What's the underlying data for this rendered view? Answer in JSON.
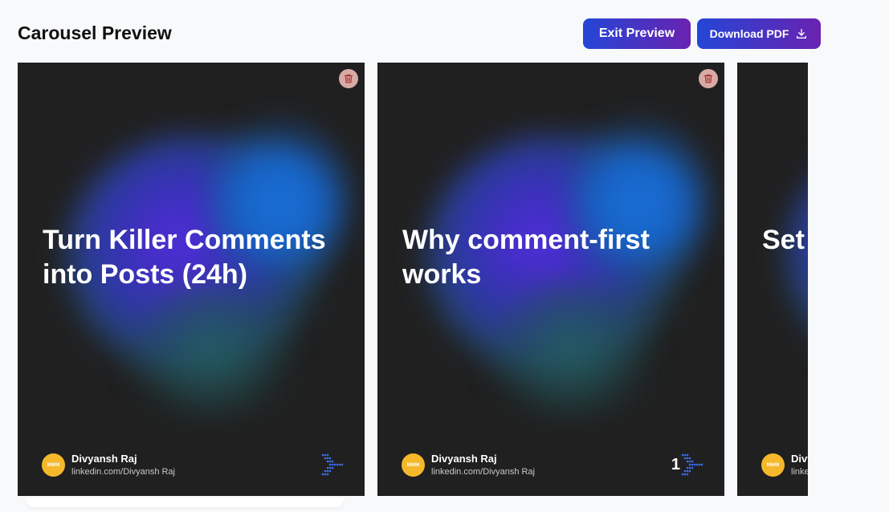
{
  "header": {
    "title": "Carousel Preview",
    "exit_label": "Exit Preview",
    "download_label": "Download PDF"
  },
  "slides": [
    {
      "heading": "Turn Killer Comments into Posts (24h)",
      "author_name": "Divyansh Raj",
      "author_link": "linkedin.com/Divyansh Raj",
      "avatar_text": "MMM",
      "page_number": ""
    },
    {
      "heading": "Why comment-first works",
      "author_name": "Divyansh Raj",
      "author_link": "linkedin.com/Divyansh Raj",
      "avatar_text": "MMM",
      "page_number": "1"
    },
    {
      "heading": "Set trig",
      "author_name": "Divyansh Raj",
      "author_link": "linkedin.com/Divyansh Raj",
      "avatar_text": "MMM",
      "page_number": ""
    }
  ],
  "icons": {
    "delete": "trash-icon",
    "download": "download-icon",
    "next": "dotted-arrow-icon"
  },
  "colors": {
    "button_gradient_start": "#2446d6",
    "button_gradient_end": "#6a22b0",
    "slide_bg": "#202020",
    "avatar_bg": "#f5b82a",
    "arrow_dots": "#3a6df0"
  }
}
